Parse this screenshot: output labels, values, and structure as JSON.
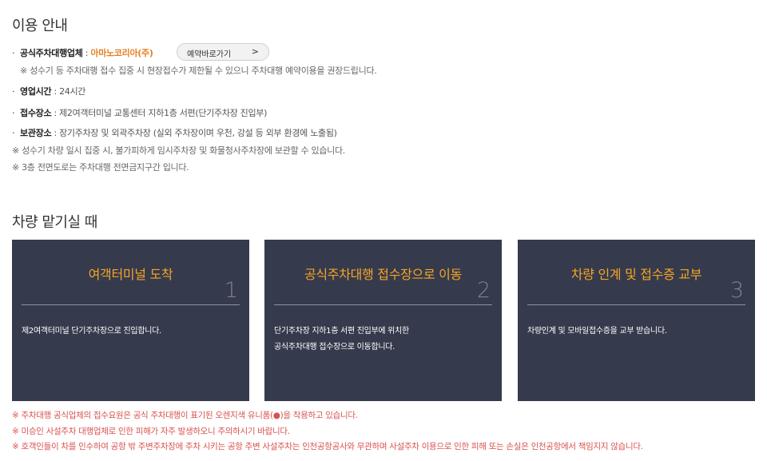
{
  "section1": {
    "title": "이용 안내",
    "official": {
      "label": "공식주차대행업체",
      "sep": " : ",
      "value": "아마노코리아(주)",
      "button": "예약바로가기",
      "note": "※ 성수기 등 주차대행 접수 집중 시 현장접수가 제한될 수 있으니 주차대행 예약이용을 권장드립니다."
    },
    "hours": {
      "label": "영업시간",
      "value": " : 24시간"
    },
    "reception": {
      "label": "접수장소",
      "value": " : 제2여객터미널 교통센터 지하1층 서편(단기주차장 진입부)"
    },
    "storage": {
      "label": "보관장소",
      "value": " : 장기주차장 및 외곽주차장 (실외 주차장이며 우천, 강설 등 외부 환경에 노출됨)"
    },
    "notes": [
      "※ 성수기 차량 일시 집중 시, 불가피하게 임시주차장 및 화물청사주차장에 보관할 수 있습니다.",
      "※ 3층 전면도로는 주차대행 전면금지구간 입니다."
    ]
  },
  "section2": {
    "title": "차량 맡기실 때",
    "cards": [
      {
        "title": "여객터미널 도착",
        "num": "1",
        "desc1": "제2여객터미널 단기주차장으로 진입합니다.",
        "desc2": ""
      },
      {
        "title": "공식주차대행 접수장으로 이동",
        "num": "2",
        "desc1": "단기주차장 지하1층 서편 진입부에 위치한",
        "desc2": "공식주차대행 접수장으로 이동합니다."
      },
      {
        "title": "차량 인계 및 접수증 교부",
        "num": "3",
        "desc1": "차량인계 및 모바일접수증을 교부 받습니다.",
        "desc2": ""
      }
    ],
    "warnings": [
      "※ 주차대행 공식업체의 접수요원은 공식 주차대행이 표기된 오렌지색 유니폼(●)을 착용하고 있습니다.",
      "※ 미승인 사설주차 대행업체로 인한 피해가 자주 발생하오니 주의하시기 바랍니다.",
      "※ 호객인들이 차를 인수하여 공항 밖 주변주차장에 주차 시키는 공항 주변 사설주차는 인천공항공사와 무관하며 사설주차 이용으로 인한 피해 또는 손실은 인천공항에서 책임지지 않습니다."
    ]
  },
  "colors": {
    "accent": "#f5a623",
    "card_bg": "#363a4d",
    "warning": "#d9534f"
  },
  "icons": {
    "button_chevron": "chevron-right-icon"
  }
}
